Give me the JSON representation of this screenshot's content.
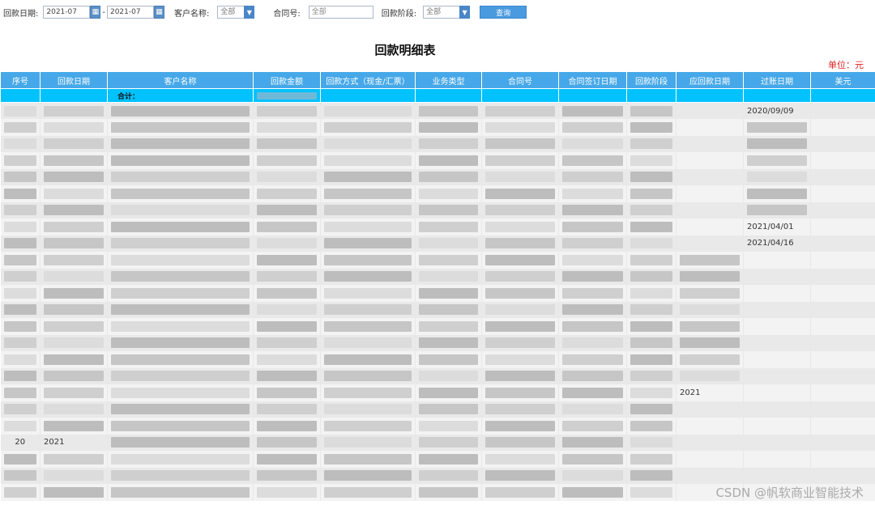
{
  "filters": {
    "date_label": "回款日期:",
    "date_from": "2021-07",
    "date_to": "2021-07",
    "date_sep": "-",
    "customer_label": "客户名称:",
    "customer_value": "全部",
    "contract_label": "合同号:",
    "contract_placeholder": "全部",
    "stage_label": "回款阶段:",
    "stage_value": "全部",
    "query_button": "查询"
  },
  "report": {
    "title": "回款明细表",
    "unit": "单位：元"
  },
  "table": {
    "columns": [
      "序号",
      "回款日期",
      "客户名称",
      "回款金额",
      "回款方式（现金/汇票）",
      "业务类型",
      "合同号",
      "合同签订日期",
      "回款阶段",
      "应回款日期",
      "过账日期",
      "美元"
    ],
    "sum_label": "合计：",
    "visible_values": {
      "row1_post_date": "2020/09/09",
      "row8_post_date": "2021/04/01",
      "row9_post_date": "2021/04/16",
      "row18_due_date": "2021",
      "row21_index": "20",
      "row21_date": "2021"
    }
  },
  "watermark": "CSDN @帆软商业智能技术",
  "colors": {
    "header_bg": "#46a8e8",
    "sum_row_bg": "#00c2ff",
    "unit_text": "#e02020",
    "button_bg": "#4a9ae0"
  },
  "icons": {
    "calendar": "calendar-icon",
    "dropdown": "chevron-down-icon"
  }
}
